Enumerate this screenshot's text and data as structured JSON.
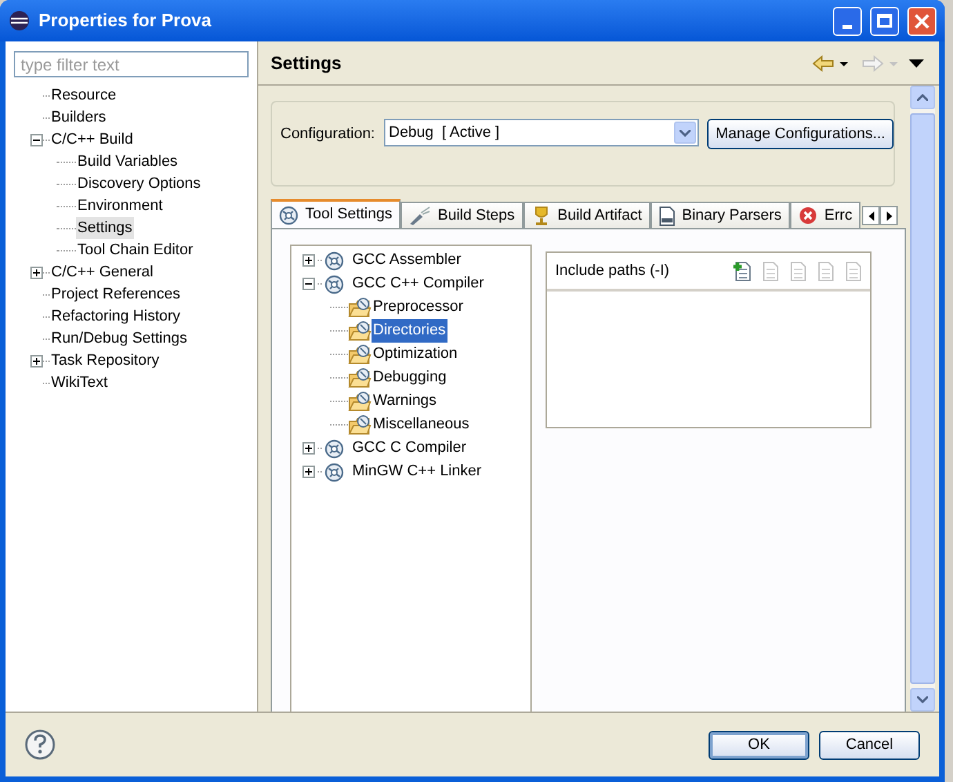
{
  "window": {
    "title": "Properties for Prova"
  },
  "filter": {
    "placeholder": "type filter text"
  },
  "nav": [
    {
      "label": "Resource",
      "selected": false
    },
    {
      "label": "Builders",
      "selected": false
    },
    {
      "label": "C/C++ Build",
      "selected": false,
      "expanded": true,
      "children": [
        {
          "label": "Build Variables",
          "selected": false
        },
        {
          "label": "Discovery Options",
          "selected": false
        },
        {
          "label": "Environment",
          "selected": false
        },
        {
          "label": "Settings",
          "selected": true
        },
        {
          "label": "Tool Chain Editor",
          "selected": false
        }
      ]
    },
    {
      "label": "C/C++ General",
      "selected": false,
      "expanded": false
    },
    {
      "label": "Project References",
      "selected": false
    },
    {
      "label": "Refactoring History",
      "selected": false
    },
    {
      "label": "Run/Debug Settings",
      "selected": false
    },
    {
      "label": "Task Repository",
      "selected": false,
      "expanded": false
    },
    {
      "label": "WikiText",
      "selected": false
    }
  ],
  "page": {
    "title": "Settings"
  },
  "configuration": {
    "label": "Configuration:",
    "value": "Debug  [ Active ]",
    "button": "Manage Configurations..."
  },
  "tabs": [
    {
      "label": "Tool Settings",
      "kind": "tool",
      "selected": true
    },
    {
      "label": "Build Steps",
      "kind": "steps",
      "selected": false
    },
    {
      "label": "Build Artifact",
      "kind": "artifact",
      "selected": false
    },
    {
      "label": "Binary Parsers",
      "kind": "binary",
      "selected": false
    },
    {
      "label": "Errc",
      "kind": "error",
      "selected": false
    }
  ],
  "tools": [
    {
      "label": "GCC Assembler",
      "selected": false,
      "expanded": false
    },
    {
      "label": "GCC C++ Compiler",
      "selected": false,
      "expanded": true,
      "children": [
        {
          "label": "Preprocessor",
          "selected": false
        },
        {
          "label": "Directories",
          "selected": true
        },
        {
          "label": "Optimization",
          "selected": false
        },
        {
          "label": "Debugging",
          "selected": false
        },
        {
          "label": "Warnings",
          "selected": false
        },
        {
          "label": "Miscellaneous",
          "selected": false
        }
      ]
    },
    {
      "label": "GCC C Compiler",
      "selected": false,
      "expanded": false
    },
    {
      "label": "MinGW C++ Linker",
      "selected": false,
      "expanded": false
    }
  ],
  "include_paths": {
    "title": "Include paths (-I)"
  },
  "buttons": [
    {
      "label": "OK",
      "default": true
    },
    {
      "label": "Cancel",
      "default": false
    }
  ]
}
